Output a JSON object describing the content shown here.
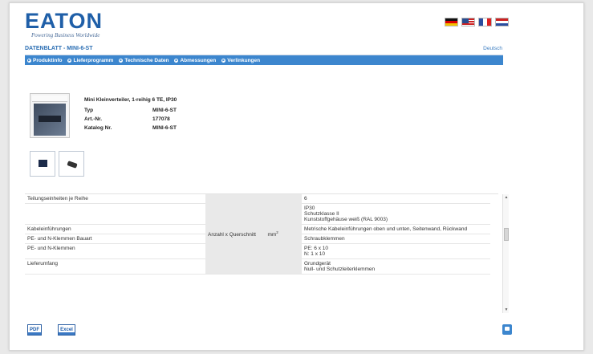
{
  "brand": {
    "name": "EATON",
    "tagline": "Powering Business Worldwide"
  },
  "header": {
    "doc_title": "DATENBLATT - MINI-6-ST",
    "language": "Deutsch",
    "flags": [
      "de-flag-icon",
      "us-flag-icon",
      "fr-flag-icon",
      "nl-flag-icon"
    ]
  },
  "nav": {
    "items": [
      {
        "label": "Produktinfo"
      },
      {
        "label": "Lieferprogramm"
      },
      {
        "label": "Technische Daten"
      },
      {
        "label": "Abmessungen"
      },
      {
        "label": "Verlinkungen"
      }
    ]
  },
  "product": {
    "title": "Mini Kleinverteiler, 1-reihig 6 TE, IP30",
    "rows": [
      {
        "key": "Typ",
        "value": "MINI-6-ST"
      },
      {
        "key": "Art.-Nr.",
        "value": "177078"
      },
      {
        "key": "Katalog Nr.",
        "value": "MINI-6-ST"
      }
    ]
  },
  "specs": {
    "merged_label": "Anzahl x Querschnitt",
    "merged_unit": "mm",
    "merged_unit_sup": "2",
    "rows": [
      {
        "label": "Teilungseinheiten je Reihe",
        "value": "6"
      },
      {
        "label": "",
        "value": "IP30\nSchutzklasse II\nKunststoffgehäuse weiß (RAL 9003)"
      },
      {
        "label": "Kabeleinführungen",
        "value": "Metrische Kabeleinführungen oben und unten, Seitenwand, Rückwand"
      },
      {
        "label": "PE- und N-Klemmen Bauart",
        "value": "Schraubklemmen"
      },
      {
        "label": "PE- und N-Klemmen",
        "value": "PE: 6 x 10\nN: 1 x 10"
      },
      {
        "label": "Lieferumfang",
        "value": "Grundgerät\nNull- und Schutzleiterklemmen"
      }
    ]
  },
  "footer": {
    "pdf_label": "PDF",
    "excel_label": "Excel"
  },
  "colors": {
    "brand_blue": "#1f5fa8",
    "nav_blue": "#3c86ce"
  }
}
